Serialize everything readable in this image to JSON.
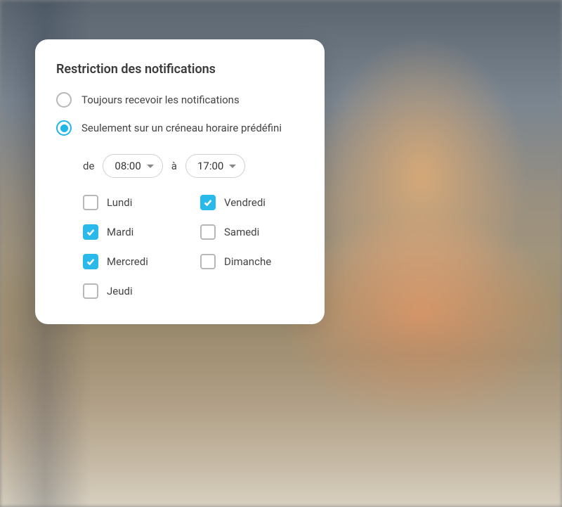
{
  "card": {
    "title": "Restriction des notifications",
    "radioOptions": {
      "always": {
        "label": "Toujours recevoir les notifications",
        "checked": false
      },
      "schedule": {
        "label": "Seulement sur un créneau horaire prédéfini",
        "checked": true
      }
    },
    "time": {
      "fromLabel": "de",
      "fromValue": "08:00",
      "toLabel": "à",
      "toValue": "17:00"
    },
    "days": {
      "monday": {
        "label": "Lundi",
        "checked": false
      },
      "tuesday": {
        "label": "Mardi",
        "checked": true
      },
      "wednesday": {
        "label": "Mercredi",
        "checked": true
      },
      "thursday": {
        "label": "Jeudi",
        "checked": false
      },
      "friday": {
        "label": "Vendredi",
        "checked": true
      },
      "saturday": {
        "label": "Samedi",
        "checked": false
      },
      "sunday": {
        "label": "Dimanche",
        "checked": false
      }
    }
  }
}
